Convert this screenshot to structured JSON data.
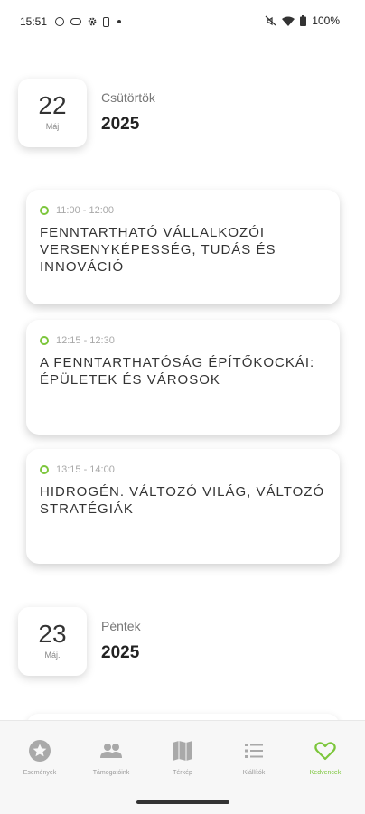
{
  "status_bar": {
    "time": "15:51",
    "battery": "100%",
    "icons": [
      "circle-icon",
      "key-icon",
      "gear-icon",
      "phone-icon",
      "dot-icon",
      "mute-icon",
      "wifi-icon",
      "battery-icon"
    ]
  },
  "days": [
    {
      "day": "22",
      "month": "Máj",
      "weekday": "Csütörtök",
      "year": "2025",
      "events": [
        {
          "time": "11:00 - 12:00",
          "title": "FENNTARTHATÓ VÁLLALKOZÓI VERSENYKÉPESSÉG, TUDÁS ÉS INNOVÁCIÓ"
        },
        {
          "time": "12:15 - 12:30",
          "title": "A FENNTARTHATÓSÁG ÉPÍTŐKOCKÁI: ÉPÜLETEK ÉS VÁROSOK"
        },
        {
          "time": "13:15 - 14:00",
          "title": "HIDROGÉN. VÁLTOZÓ VILÁG, VÁLTOZÓ STRATÉGIÁK"
        }
      ]
    },
    {
      "day": "23",
      "month": "Máj.",
      "weekday": "Péntek",
      "year": "2025"
    }
  ],
  "nav": {
    "items": [
      {
        "label": "Események",
        "icon": "star-icon"
      },
      {
        "label": "Támogatóink",
        "icon": "people-icon"
      },
      {
        "label": "Térkép",
        "icon": "map-icon"
      },
      {
        "label": "Kiállítók",
        "icon": "list-icon"
      },
      {
        "label": "Kedvencek",
        "icon": "heart-icon"
      }
    ],
    "active_index": 4
  },
  "colors": {
    "accent": "#7cc63b",
    "inactive_icon": "#a9a9a9"
  }
}
